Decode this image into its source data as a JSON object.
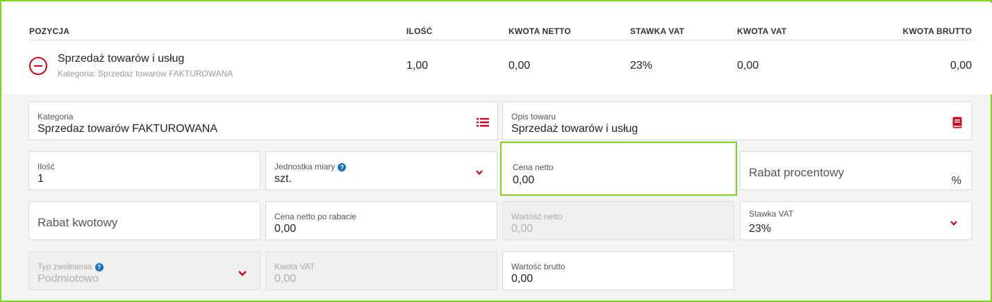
{
  "table": {
    "headers": {
      "pozycja": "POZYCJA",
      "ilosc": "ILOŚĆ",
      "kwota_netto": "KWOTA NETTO",
      "stawka_vat": "STAWKA VAT",
      "kwota_vat": "KWOTA VAT",
      "kwota_brutto": "KWOTA BRUTTO"
    },
    "row": {
      "name": "Sprzedaż towarów i usług",
      "category": "Kategoria: Sprzedaz towarów FAKTUROWANA",
      "ilosc": "1,00",
      "kwota_netto": "0,00",
      "stawka_vat": "23%",
      "kwota_vat": "0,00",
      "kwota_brutto": "0,00"
    }
  },
  "form": {
    "kategoria": {
      "label": "Kategoria",
      "value": "Sprzedaz towarów FAKTUROWANA"
    },
    "opis": {
      "label": "Opis towaru",
      "value": "Sprzedaż towarów i usług"
    },
    "ilosc": {
      "label": "Ilość",
      "value": "1"
    },
    "jednostka": {
      "label": "Jednostka miary",
      "value": "szt."
    },
    "cena_netto": {
      "label": "Cena netto",
      "value": "0,00"
    },
    "rabat_procentowy": {
      "placeholder": "Rabat procentowy",
      "suffix": "%"
    },
    "rabat_kwotowy": {
      "placeholder": "Rabat kwotowy"
    },
    "cena_po_rabacie": {
      "label": "Cena netto po rabacie",
      "value": "0,00"
    },
    "wartosc_netto": {
      "label": "Wartość netto",
      "value": "0,00"
    },
    "stawka_vat": {
      "label": "Stawka VAT",
      "value": "23%"
    },
    "typ_zwolnienia": {
      "label": "Typ zwolnienia",
      "value": "Podmiotowo"
    },
    "kwota_vat": {
      "label": "Kwota VAT",
      "value": "0,00"
    },
    "wartosc_brutto": {
      "label": "Wartość brutto",
      "value": "0,00"
    },
    "help_glyph": "?"
  },
  "colors": {
    "accent_green": "#7ed321",
    "danger_red": "#d0021b",
    "help_blue": "#1a73b8"
  }
}
